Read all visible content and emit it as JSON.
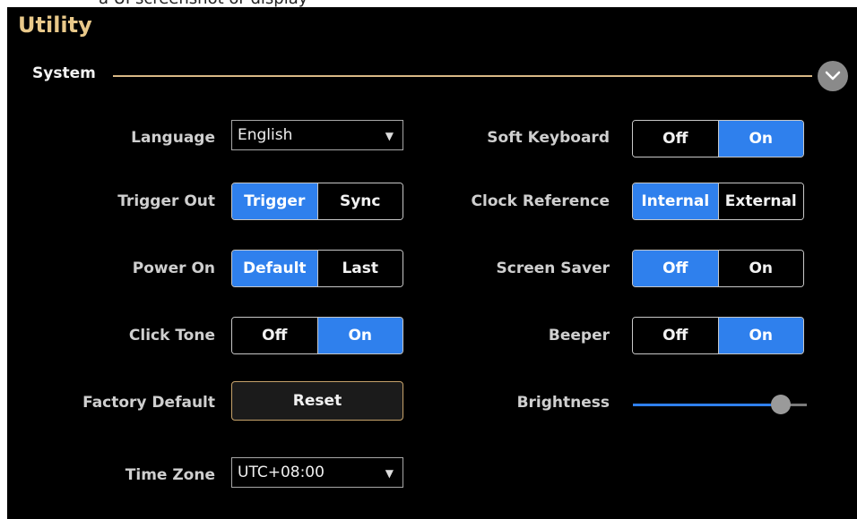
{
  "top_hint": "a UI screenshot or display",
  "window": {
    "title": "Utility"
  },
  "section": {
    "label": "System"
  },
  "left": {
    "language": {
      "label": "Language",
      "value": "English"
    },
    "trigger_out": {
      "label": "Trigger Out",
      "options": [
        "Trigger",
        "Sync"
      ],
      "selected": "Trigger"
    },
    "power_on": {
      "label": "Power On",
      "options": [
        "Default",
        "Last"
      ],
      "selected": "Default"
    },
    "click_tone": {
      "label": "Click Tone",
      "options": [
        "Off",
        "On"
      ],
      "selected": "On"
    },
    "factory_default": {
      "label": "Factory Default",
      "button": "Reset"
    },
    "time_zone": {
      "label": "Time Zone",
      "value": "UTC+08:00"
    }
  },
  "right": {
    "soft_keyboard": {
      "label": "Soft Keyboard",
      "options": [
        "Off",
        "On"
      ],
      "selected": "On"
    },
    "clock_reference": {
      "label": "Clock Reference",
      "options": [
        "Internal",
        "External"
      ],
      "selected": "Internal"
    },
    "screen_saver": {
      "label": "Screen Saver",
      "options": [
        "Off",
        "On"
      ],
      "selected": "Off"
    },
    "beeper": {
      "label": "Beeper",
      "options": [
        "Off",
        "On"
      ],
      "selected": "On"
    },
    "brightness": {
      "label": "Brightness",
      "level_percent": 85
    }
  },
  "colors": {
    "accent": "#2f80ed",
    "title": "#e9c98a",
    "divider": "#d8b886"
  },
  "icons": {
    "collapse": "chevron-down-icon",
    "dropdown": "caret-down-icon"
  }
}
